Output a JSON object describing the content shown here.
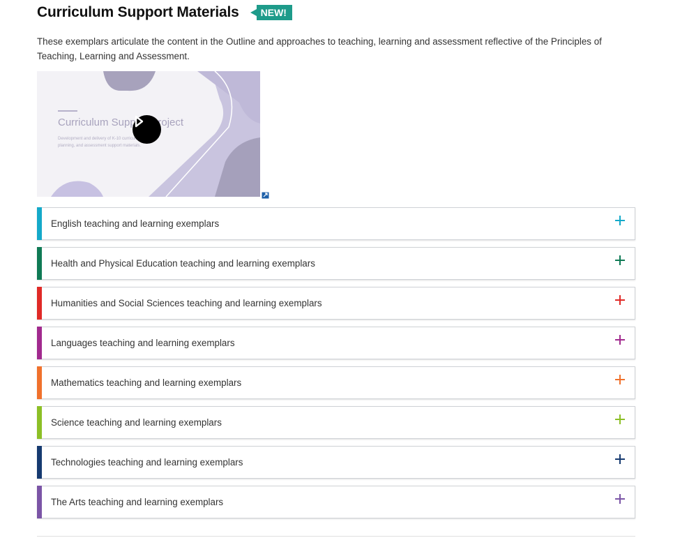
{
  "header": {
    "title": "Curriculum Support Materials",
    "badge": "NEW!",
    "badge_color": "#1e9b8a"
  },
  "intro_text": "These exemplars articulate the content in the Outline and approaches to teaching, learning and assessment reflective of the Principles of Teaching, Learning and Assessment.",
  "video": {
    "title": "Curriculum Support Project",
    "subtitle": "Development and delivery of K-10 curriculum planning, and assessment support materials.",
    "play_icon": "play-icon",
    "external_icon": "external-link-icon"
  },
  "accordion": [
    {
      "label": "English teaching and learning exemplars",
      "color": "#14a9c9"
    },
    {
      "label": "Health and Physical Education teaching and learning exemplars",
      "color": "#0f7a55"
    },
    {
      "label": "Humanities and Social Sciences teaching and learning exemplars",
      "color": "#e02a27"
    },
    {
      "label": "Languages teaching and learning exemplars",
      "color": "#a12a8e"
    },
    {
      "label": "Mathematics teaching and learning exemplars",
      "color": "#f0712c"
    },
    {
      "label": "Science teaching and learning exemplars",
      "color": "#8cbf26"
    },
    {
      "label": "Technologies teaching and learning exemplars",
      "color": "#163a70"
    },
    {
      "label": "The Arts teaching and learning exemplars",
      "color": "#7b55a6"
    }
  ]
}
